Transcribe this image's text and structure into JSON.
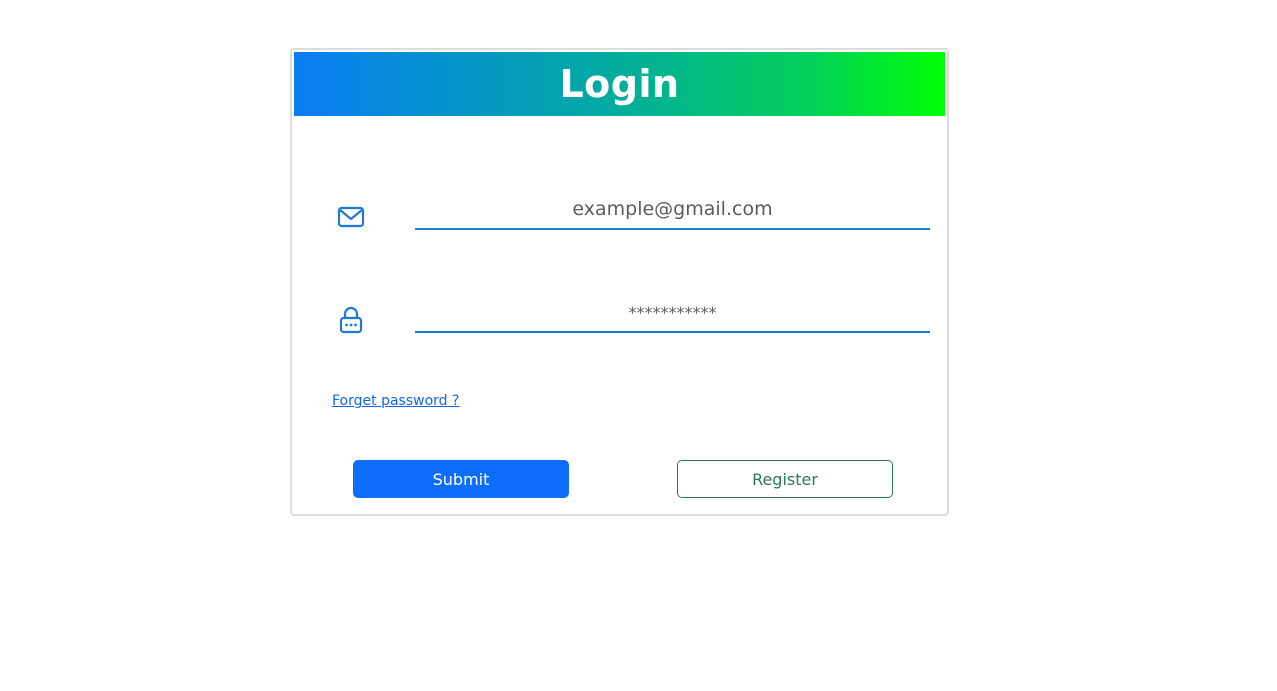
{
  "login_card": {
    "title": "Login",
    "header_gradient": [
      "#0a7cf5",
      "#00ff04"
    ],
    "email": {
      "icon": "envelope-icon",
      "value": "",
      "placeholder": "example@gmail.com"
    },
    "password": {
      "icon": "lock-icon",
      "value": "",
      "placeholder": "***********"
    },
    "forgot_password_link": "Forget password ?",
    "submit_label": "Submit",
    "register_label": "Register"
  },
  "colors": {
    "accent_blue": "#0d6efd",
    "underline_blue": "#1f7ad6",
    "register_green": "#2a7a4f",
    "link_blue": "#1565e6"
  }
}
